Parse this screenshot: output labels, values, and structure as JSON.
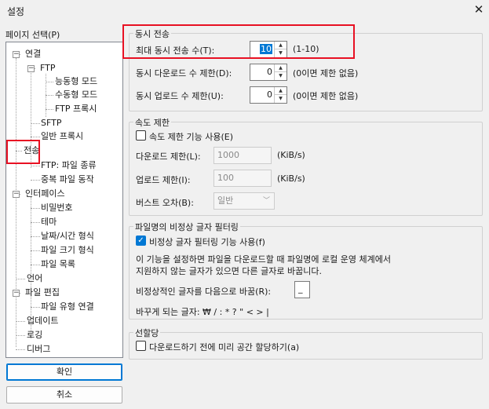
{
  "window": {
    "title": "설정",
    "close_icon": "close-icon"
  },
  "page_select_label": "페이지 선택(P)",
  "tree": {
    "connection": "연결",
    "ftp": "FTP",
    "active": "능동형 모드",
    "passive": "수동형 모드",
    "ftp_proxy": "FTP 프록시",
    "sftp": "SFTP",
    "generic_proxy": "일반 프록시",
    "transfer": "전송",
    "ftp_filetype": "FTP: 파일 종류",
    "duplicate": "중복 파일 동작",
    "interface": "인터페이스",
    "passwords": "비밀번호",
    "themes": "테마",
    "datetime": "날짜/시간 형식",
    "filesize": "파일 크기 형식",
    "filelists": "파일 목록",
    "language": "언어",
    "file_editing": "파일 편집",
    "filetype_assoc": "파일 유형 연결",
    "updates": "업데이트",
    "logging": "로깅",
    "debug": "디버그"
  },
  "buttons": {
    "ok": "확인",
    "cancel": "취소"
  },
  "concurrent": {
    "title": "동시 전송",
    "max_label": "최대 동시 전송 수(T):",
    "max_value": "10",
    "max_range": "(1-10)",
    "dl_label": "동시 다운로드 수 제한(D):",
    "dl_value": "0",
    "dl_hint": "(0이면 제한 없음)",
    "ul_label": "동시 업로드 수 제한(U):",
    "ul_value": "0",
    "ul_hint": "(0이면 제한 없음)"
  },
  "speed": {
    "title": "속도 제한",
    "enable_label": "속도 제한 기능 사용(E)",
    "enabled": false,
    "dl_label": "다운로드 제한(L):",
    "dl_value": "1000",
    "dl_unit": "(KiB/s)",
    "ul_label": "업로드 제한(I):",
    "ul_value": "100",
    "ul_unit": "(KiB/s)",
    "burst_label": "버스트 오차(B):",
    "burst_value": "일반"
  },
  "filter": {
    "title": "파일명의 비정상 글자 필터링",
    "enable_label": "비정상 글자 필터링 기능 사용(f)",
    "enabled": true,
    "desc1": "이 기능을 설정하면 파일을 다운로드할 때 파일명에 로컬 운영 체계에서",
    "desc2": "지원하지 않는 글자가 있으면 다른 글자로 바꿉니다.",
    "replace_label": "비정상적인 글자를 다음으로 바꿈(R):",
    "replace_value": "_",
    "replaced_chars": "바꾸게 되는 글자: ₩ / : * ? \" < > |"
  },
  "prealloc": {
    "title": "선할당",
    "label": "다운로드하기 전에 미리 공간 할당하기(a)",
    "enabled": false
  },
  "highlight_color": "#e81123",
  "accent_color": "#0078d4"
}
